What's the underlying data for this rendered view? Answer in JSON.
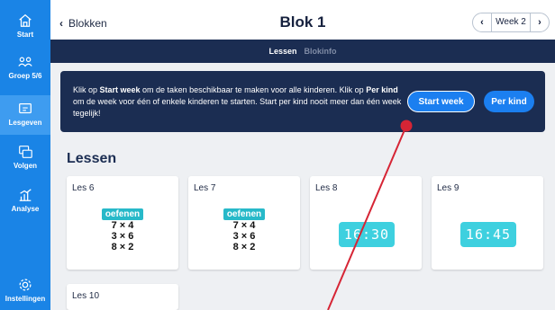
{
  "sidebar": {
    "items": [
      {
        "label": "Start",
        "icon": "home-icon"
      },
      {
        "label": "Groep 5/6",
        "icon": "group-icon"
      },
      {
        "label": "Lesgeven",
        "icon": "teach-icon"
      },
      {
        "label": "Volgen",
        "icon": "follow-icon"
      },
      {
        "label": "Analyse",
        "icon": "chart-icon"
      },
      {
        "label": "Instellingen",
        "icon": "gear-icon"
      }
    ],
    "active": "Lesgeven"
  },
  "header": {
    "back_label": "Blokken",
    "title": "Blok 1",
    "week_label": "Week 2"
  },
  "tabs": [
    {
      "label": "Lessen",
      "active": true
    },
    {
      "label": "Blokinfo",
      "active": false
    }
  ],
  "info": {
    "text_1": "Klik op ",
    "bold_1": "Start week",
    "text_2": " om de taken beschikbaar te maken voor alle kinderen. Klik op ",
    "bold_2": "Per kind",
    "text_3": " om de week voor één of enkele kinderen te starten. Start per kind nooit meer dan één week tegelijk!",
    "start_week_button": "Start week",
    "per_kind_button": "Per kind"
  },
  "section_title": "Lessen",
  "lessons": [
    {
      "label": "Les 6",
      "badge": "oefenen",
      "sums": [
        "7 × 4",
        "3 × 6",
        "8 × 2"
      ]
    },
    {
      "label": "Les 7",
      "badge": "oefenen",
      "sums": [
        "7 × 4",
        "3 × 6",
        "8 × 2"
      ]
    },
    {
      "label": "Les 8",
      "clock": "16:30"
    },
    {
      "label": "Les 9",
      "clock": "16:45"
    },
    {
      "label": "Les 10"
    }
  ],
  "colors": {
    "sidebar": "#1a84e6",
    "navy": "#1b2d52",
    "button": "#1b7ff0",
    "badge": "#27b9c9",
    "clock": "#3ed0df",
    "annotation_line": "#d62535"
  }
}
